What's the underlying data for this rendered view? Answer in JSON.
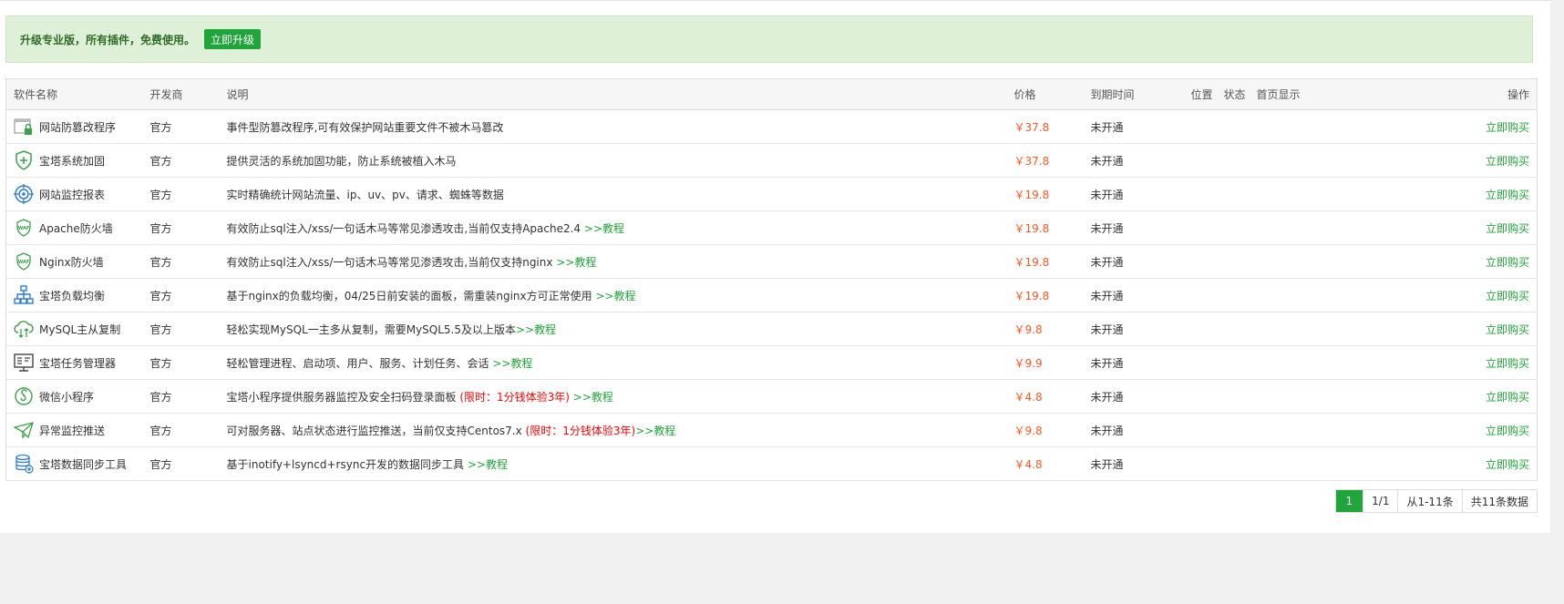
{
  "banner": {
    "text": "升级专业版，所有插件，免费使用。",
    "upgrade_label": "立即升级"
  },
  "table": {
    "headers": {
      "name": "软件名称",
      "developer": "开发商",
      "desc": "说明",
      "price": "价格",
      "expire": "到期时间",
      "position": "位置",
      "status": "状态",
      "homepage": "首页显示",
      "action": "操作"
    },
    "rows": [
      {
        "icon": "tamper-protect-icon",
        "name": "网站防篡改程序",
        "developer": "官方",
        "desc": "事件型防篡改程序,可有效保护网站重要文件不被木马篡改",
        "limit": "",
        "tutorial": "",
        "price": "￥37.8",
        "expire": "未开通",
        "action": "立即购买"
      },
      {
        "icon": "shield-plus-icon",
        "name": "宝塔系统加固",
        "developer": "官方",
        "desc": "提供灵活的系统加固功能，防止系统被植入木马",
        "limit": "",
        "tutorial": "",
        "price": "￥37.8",
        "expire": "未开通",
        "action": "立即购买"
      },
      {
        "icon": "target-icon",
        "name": "网站监控报表",
        "developer": "官方",
        "desc": "实时精确统计网站流量、ip、uv、pv、请求、蜘蛛等数据",
        "limit": "",
        "tutorial": "",
        "price": "￥19.8",
        "expire": "未开通",
        "action": "立即购买"
      },
      {
        "icon": "waf-shield-icon",
        "name": "Apache防火墙",
        "developer": "官方",
        "desc": "有效防止sql注入/xss/一句话木马等常见渗透攻击,当前仅支持Apache2.4 ",
        "limit": "",
        "tutorial": ">>教程",
        "price": "￥19.8",
        "expire": "未开通",
        "action": "立即购买"
      },
      {
        "icon": "waf-shield-icon",
        "name": "Nginx防火墙",
        "developer": "官方",
        "desc": "有效防止sql注入/xss/一句话木马等常见渗透攻击,当前仅支持nginx ",
        "limit": "",
        "tutorial": ">>教程",
        "price": "￥19.8",
        "expire": "未开通",
        "action": "立即购买"
      },
      {
        "icon": "load-balance-icon",
        "name": "宝塔负载均衡",
        "developer": "官方",
        "desc": "基于nginx的负载均衡，04/25日前安装的面板，需重装nginx方可正常使用 ",
        "limit": "",
        "tutorial": ">>教程",
        "price": "￥19.8",
        "expire": "未开通",
        "action": "立即购买"
      },
      {
        "icon": "cloud-sync-icon",
        "name": "MySQL主从复制",
        "developer": "官方",
        "desc": "轻松实现MySQL一主多从复制，需要MySQL5.5及以上版本",
        "limit": "",
        "tutorial": ">>教程",
        "price": "￥9.8",
        "expire": "未开通",
        "action": "立即购买"
      },
      {
        "icon": "task-manager-icon",
        "name": "宝塔任务管理器",
        "developer": "官方",
        "desc": "轻松管理进程、启动项、用户、服务、计划任务、会话 ",
        "limit": "",
        "tutorial": ">>教程",
        "price": "￥9.9",
        "expire": "未开通",
        "action": "立即购买"
      },
      {
        "icon": "mini-program-icon",
        "name": "微信小程序",
        "developer": "官方",
        "desc": "宝塔小程序提供服务器监控及安全扫码登录面板 ",
        "limit": "(限时：1分钱体验3年)",
        "tutorial": " >>教程",
        "price": "￥4.8",
        "expire": "未开通",
        "action": "立即购买"
      },
      {
        "icon": "paper-plane-icon",
        "name": "异常监控推送",
        "developer": "官方",
        "desc": "可对服务器、站点状态进行监控推送，当前仅支持Centos7.x ",
        "limit": "(限时：1分钱体验3年)",
        "tutorial": ">>教程",
        "price": "￥9.8",
        "expire": "未开通",
        "action": "立即购买"
      },
      {
        "icon": "database-sync-icon",
        "name": "宝塔数据同步工具",
        "developer": "官方",
        "desc": "基于inotify+lsyncd+rsync开发的数据同步工具 ",
        "limit": "",
        "tutorial": ">>教程",
        "price": "￥4.8",
        "expire": "未开通",
        "action": "立即购买"
      }
    ]
  },
  "pager": {
    "current": "1",
    "pages": "1/1",
    "range": "从1-11条",
    "total": "共11条数据"
  },
  "colors": {
    "accent": "#20a53a",
    "price": "#ff5722",
    "limit": "#ff0000",
    "banner_bg": "#dff0d8"
  }
}
